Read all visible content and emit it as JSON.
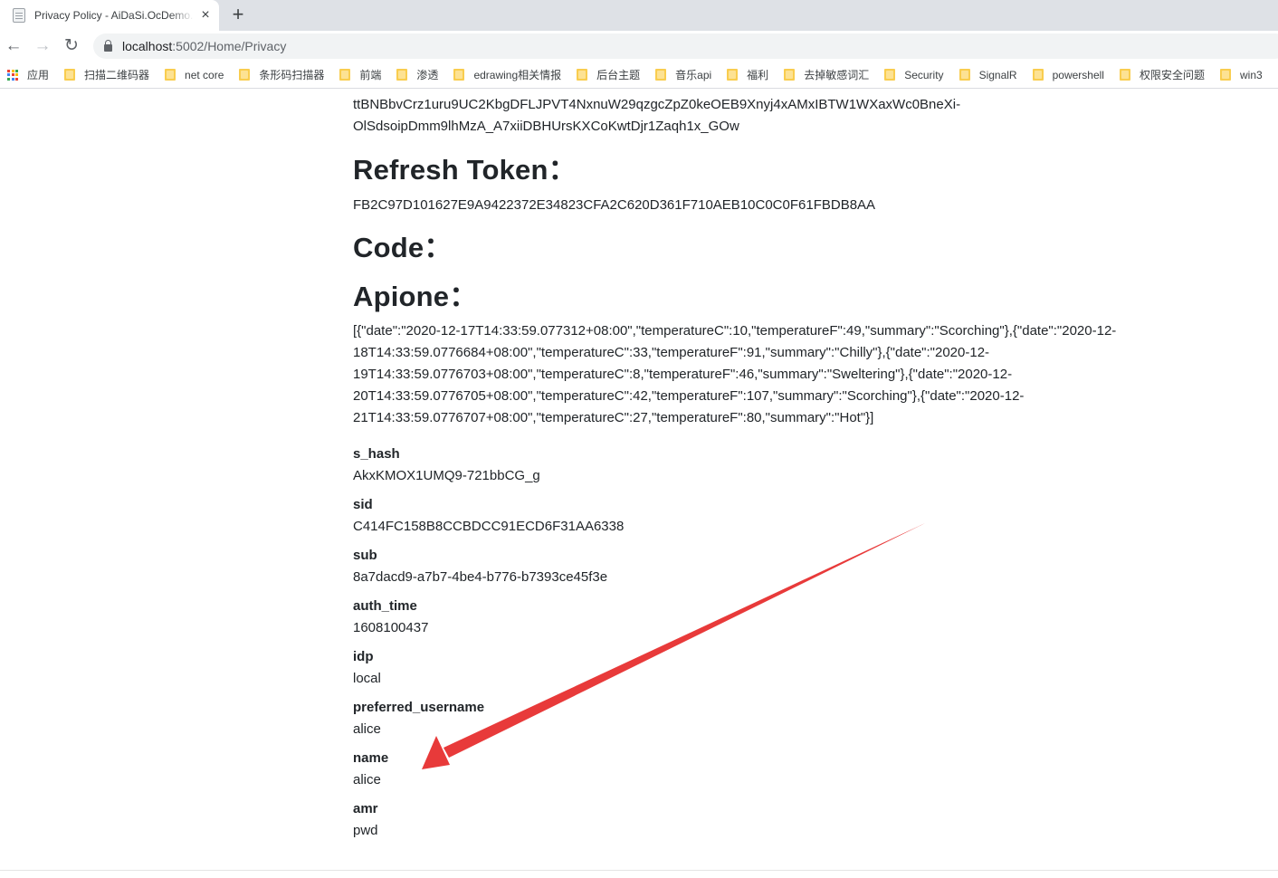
{
  "browser": {
    "tab_title": "Privacy Policy - AiDaSi.OcDemo.M",
    "url_host": "localhost",
    "url_rest": ":5002/Home/Privacy",
    "back_icon": "←",
    "forward_icon": "→",
    "reload_icon": "↻",
    "close_icon": "×",
    "newtab_icon": "+"
  },
  "bookmarks": {
    "apps_label": "应用",
    "items": [
      "扫描二维码器",
      "net core",
      "条形码扫描器",
      "前端",
      "渗透",
      "edrawing相关情报",
      "后台主题",
      "音乐api",
      "福利",
      "去掉敏感词汇",
      "Security",
      "SignalR",
      "powershell",
      "权限安全问题",
      "win3"
    ]
  },
  "page": {
    "token_tail": [
      "ttBNBbvCrz1uru9UC2KbgDFLJPVT4NxnuW29qzgcZpZ0keOEB9Xnyj4xAMxIBTW1WXaxWc0BneXi-",
      "OlSdsoipDmm9lhMzA_A7xiiDBHUrsKXCoKwtDjr1Zaqh1x_GOw"
    ],
    "refresh_heading": "Refresh Token：",
    "refresh_value": "FB2C97D101627E9A9422372E34823CFA2C620D361F710AEB10C0C0F61FBDB8AA",
    "code_heading": "Code：",
    "apione_heading": "Apione：",
    "apione_lines": [
      "[{\"date\":\"2020-12-17T14:33:59.077312+08:00\",\"temperatureC\":10,\"temperatureF\":49,\"summary\":\"Scorching\"},{\"date\":\"2020-12-",
      "18T14:33:59.0776684+08:00\",\"temperatureC\":33,\"temperatureF\":91,\"summary\":\"Chilly\"},{\"date\":\"2020-12-",
      "19T14:33:59.0776703+08:00\",\"temperatureC\":8,\"temperatureF\":46,\"summary\":\"Sweltering\"},{\"date\":\"2020-12-",
      "20T14:33:59.0776705+08:00\",\"temperatureC\":42,\"temperatureF\":107,\"summary\":\"Scorching\"},{\"date\":\"2020-12-",
      "21T14:33:59.0776707+08:00\",\"temperatureC\":27,\"temperatureF\":80,\"summary\":\"Hot\"}]"
    ],
    "claims": [
      {
        "key": "s_hash",
        "value": "AkxKMOX1UMQ9-721bbCG_g"
      },
      {
        "key": "sid",
        "value": "C414FC158B8CCBDCC91ECD6F31AA6338"
      },
      {
        "key": "sub",
        "value": "8a7dacd9-a7b7-4be4-b776-b7393ce45f3e"
      },
      {
        "key": "auth_time",
        "value": "1608100437"
      },
      {
        "key": "idp",
        "value": "local"
      },
      {
        "key": "preferred_username",
        "value": "alice"
      },
      {
        "key": "name",
        "value": "alice"
      },
      {
        "key": "amr",
        "value": "pwd"
      }
    ]
  },
  "colors": {
    "annotation_arrow": "#e83a3a",
    "text": "#212529"
  }
}
